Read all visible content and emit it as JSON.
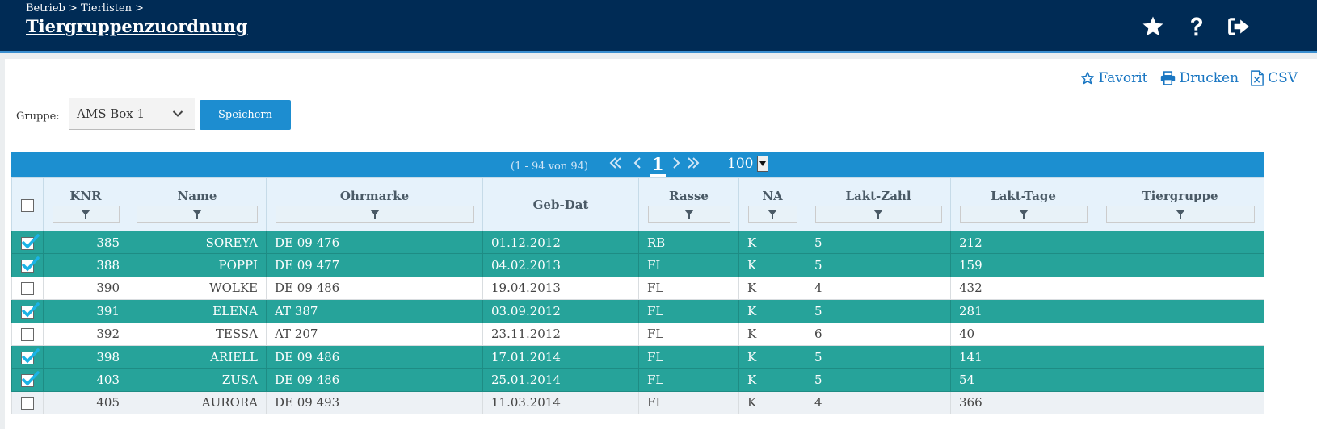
{
  "header": {
    "breadcrumb": "Betrieb > Tierlisten >",
    "title": "Tiergruppenzuordnung"
  },
  "actions": {
    "favorite": "Favorit",
    "print": "Drucken",
    "csv": "CSV"
  },
  "form": {
    "group_label": "Gruppe:",
    "group_value": "AMS Box 1",
    "save_label": "Speichern"
  },
  "pager": {
    "info": "(1 - 94 von 94)",
    "current_page": "1",
    "page_size": "100"
  },
  "columns": [
    "KNR",
    "Name",
    "Ohrmarke",
    "Geb-Dat",
    "Rasse",
    "NA",
    "Lakt-Zahl",
    "Lakt-Tage",
    "Tiergruppe"
  ],
  "rows": [
    {
      "checked": true,
      "knr": "385",
      "name": "SOREYA",
      "ohrmarke": "DE 09 476",
      "gebdat": "01.12.2012",
      "rasse": "RB",
      "na": "K",
      "laktzahl": "5",
      "lakttage": "212",
      "tiergruppe": ""
    },
    {
      "checked": true,
      "knr": "388",
      "name": "POPPI",
      "ohrmarke": "DE 09 477",
      "gebdat": "04.02.2013",
      "rasse": "FL",
      "na": "K",
      "laktzahl": "5",
      "lakttage": "159",
      "tiergruppe": ""
    },
    {
      "checked": false,
      "knr": "390",
      "name": "WOLKE",
      "ohrmarke": "DE 09 486",
      "gebdat": "19.04.2013",
      "rasse": "FL",
      "na": "K",
      "laktzahl": "4",
      "lakttage": "432",
      "tiergruppe": ""
    },
    {
      "checked": true,
      "knr": "391",
      "name": "ELENA",
      "ohrmarke": "AT 387",
      "gebdat": "03.09.2012",
      "rasse": "FL",
      "na": "K",
      "laktzahl": "5",
      "lakttage": "281",
      "tiergruppe": ""
    },
    {
      "checked": false,
      "knr": "392",
      "name": "TESSA",
      "ohrmarke": "AT 207",
      "gebdat": "23.11.2012",
      "rasse": "FL",
      "na": "K",
      "laktzahl": "6",
      "lakttage": "40",
      "tiergruppe": ""
    },
    {
      "checked": true,
      "knr": "398",
      "name": "ARIELL",
      "ohrmarke": "DE 09 486",
      "gebdat": "17.01.2014",
      "rasse": "FL",
      "na": "K",
      "laktzahl": "5",
      "lakttage": "141",
      "tiergruppe": ""
    },
    {
      "checked": true,
      "knr": "403",
      "name": "ZUSA",
      "ohrmarke": "DE 09 486",
      "gebdat": "25.01.2014",
      "rasse": "FL",
      "na": "K",
      "laktzahl": "5",
      "lakttage": "54",
      "tiergruppe": ""
    },
    {
      "checked": false,
      "knr": "405",
      "name": "AURORA",
      "ohrmarke": "DE 09 493",
      "gebdat": "11.03.2014",
      "rasse": "FL",
      "na": "K",
      "laktzahl": "4",
      "lakttage": "366",
      "tiergruppe": ""
    }
  ],
  "colors": {
    "header_bg": "#002b55",
    "accent": "#1c8fd0",
    "selected_row": "#26a39a"
  }
}
